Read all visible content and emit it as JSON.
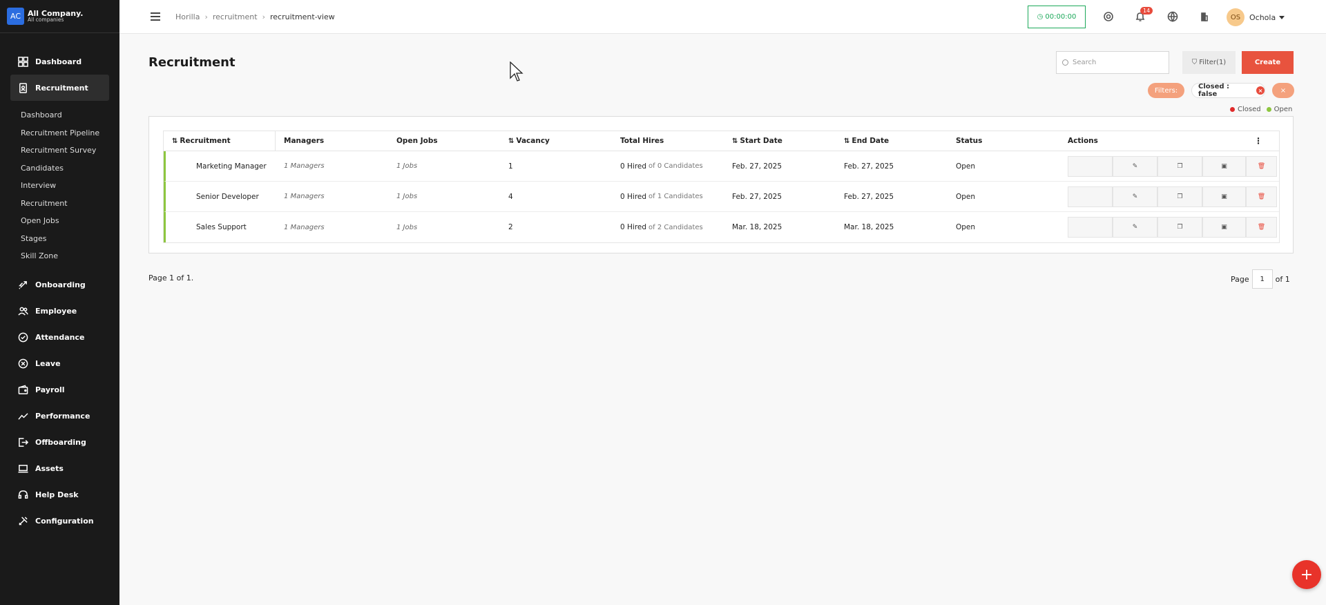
{
  "company": {
    "logo_text": "AC",
    "name": "All Company.",
    "sub": "All companies"
  },
  "sidebar": {
    "items": [
      {
        "label": "Dashboard",
        "icon": "dashboard-icon"
      },
      {
        "label": "Recruitment",
        "icon": "recruitment-icon"
      },
      {
        "label": "Onboarding",
        "icon": "rocket-icon"
      },
      {
        "label": "Employee",
        "icon": "people-icon"
      },
      {
        "label": "Attendance",
        "icon": "check-circle-icon"
      },
      {
        "label": "Leave",
        "icon": "x-circle-icon"
      },
      {
        "label": "Payroll",
        "icon": "wallet-icon"
      },
      {
        "label": "Performance",
        "icon": "trend-icon"
      },
      {
        "label": "Offboarding",
        "icon": "exit-icon"
      },
      {
        "label": "Assets",
        "icon": "laptop-icon"
      },
      {
        "label": "Help Desk",
        "icon": "headset-icon"
      },
      {
        "label": "Configuration",
        "icon": "tools-icon"
      }
    ],
    "submenu": [
      "Dashboard",
      "Recruitment Pipeline",
      "Recruitment Survey",
      "Candidates",
      "Interview",
      "Recruitment",
      "Open Jobs",
      "Stages",
      "Skill Zone"
    ]
  },
  "header": {
    "breadcrumb": [
      "Horilla",
      "recruitment",
      "recruitment-view"
    ],
    "timer": "00:00:00",
    "notification_count": "14",
    "user_initials": "OS",
    "user_name": "Ochola"
  },
  "main": {
    "title": "Recruitment",
    "search_placeholder": "Search",
    "filter_label": "Filter(1)",
    "create_label": "Create",
    "filters_label": "Filters:",
    "active_filter": "Closed : false",
    "clear_icon": "×",
    "legend": [
      {
        "label": "Closed",
        "color": "#e02b2b"
      },
      {
        "label": "Open",
        "color": "#8dc63f"
      }
    ]
  },
  "table": {
    "headers": [
      "Recruitment",
      "Managers",
      "Open Jobs",
      "Vacancy",
      "Total Hires",
      "Start Date",
      "End Date",
      "Status",
      "Actions"
    ],
    "rows": [
      {
        "recruitment": "Marketing Manager",
        "managers": "1 Managers",
        "open_jobs": "1 Jobs",
        "vacancy": "1",
        "hired": "0 Hired",
        "candidates": "of 0 Candidates",
        "start": "Feb. 27, 2025",
        "end": "Feb. 27, 2025",
        "status": "Open"
      },
      {
        "recruitment": "Senior Developer",
        "managers": "1 Managers",
        "open_jobs": "1 Jobs",
        "vacancy": "4",
        "hired": "0 Hired",
        "candidates": "of 1 Candidates",
        "start": "Feb. 27, 2025",
        "end": "Feb. 27, 2025",
        "status": "Open"
      },
      {
        "recruitment": "Sales Support",
        "managers": "1 Managers",
        "open_jobs": "1 Jobs",
        "vacancy": "2",
        "hired": "0 Hired",
        "candidates": "of 2 Candidates",
        "start": "Mar. 18, 2025",
        "end": "Mar. 18, 2025",
        "status": "Open"
      }
    ]
  },
  "pagination": {
    "summary": "Page 1 of 1.",
    "page_label": "Page",
    "page_value": "1",
    "of_label": "of 1"
  },
  "fab_label": "+"
}
